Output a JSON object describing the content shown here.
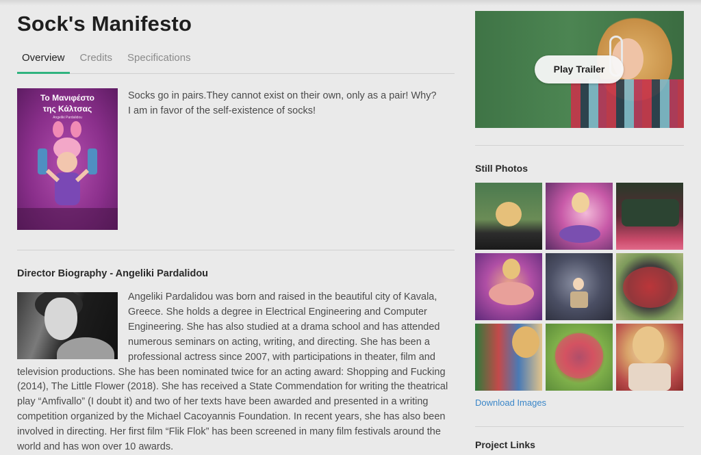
{
  "page": {
    "title": "Sock's Manifesto"
  },
  "tabs": [
    {
      "label": "Overview",
      "active": true
    },
    {
      "label": "Credits",
      "active": false
    },
    {
      "label": "Specifications",
      "active": false
    }
  ],
  "overview": {
    "poster_title_line1": "Το Μανιφέστο",
    "poster_title_line2": "της Κάλτσας",
    "poster_subtitle": "Angeliki Pardalidou",
    "synopsis_line1": "Socks go in pairs.They cannot exist on their own, only as a pair! Why?",
    "synopsis_line2": "I am in favor of the self-existence of socks!"
  },
  "biography": {
    "heading": "Director Biography - Angeliki Pardalidou",
    "text": "Angeliki Pardalidou was born and raised in the beautiful city of Kavala, Greece. She holds a degree in Electrical Engineering and Computer Engineering. She has also studied at a drama school and has attended numerous seminars on acting, writing, and directing. She has been a professional actress since 2007, with participations in theater, film and television productions. She has been nominated twice for an acting award: Shopping and Fucking (2014), The Little Flower (2018). She has received a State Commendation for writing the theatrical play “Amfivallo” (I doubt it) and two of her texts have been awarded and presented in a writing competition organized by the Michael Cacoyannis Foundation. In recent years, she has also been involved in directing. Her first film “Flik Flok” has been screened in many film festivals around the world and has won over 10 awards."
  },
  "sidebar": {
    "play_trailer_label": "Play Trailer",
    "still_photos_heading": "Still Photos",
    "download_label": "Download Images",
    "project_links_heading": "Project Links"
  },
  "colors": {
    "accent": "#2fb37e",
    "link": "#3a86c8",
    "background": "#eaeaea"
  }
}
